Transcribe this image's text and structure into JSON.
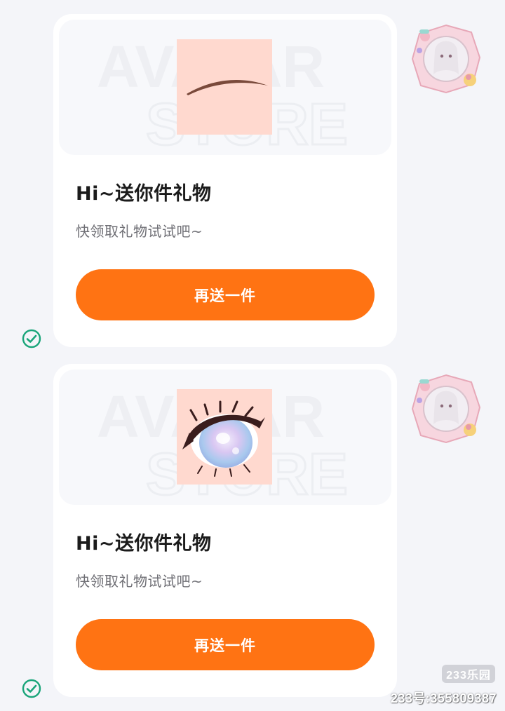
{
  "messages": [
    {
      "item": "eyebrow",
      "watermark_line1": "AVATAR",
      "watermark_line2": "STORE",
      "title": "Hi~送你件礼物",
      "subtitle": "快领取礼物试试吧~",
      "button_label": "再送一件",
      "status": "sent"
    },
    {
      "item": "eye",
      "watermark_line1": "AVATAR",
      "watermark_line2": "STORE",
      "title": "Hi~送你件礼物",
      "subtitle": "快领取礼物试试吧~",
      "button_label": "再送一件",
      "status": "sent"
    }
  ],
  "icons": {
    "status": "check-circle-icon",
    "avatar": "user-avatar"
  },
  "colors": {
    "accent": "#ff7313",
    "check": "#1aa57a",
    "card_bg": "#ffffff",
    "page_bg": "#f4f5f9"
  },
  "footer": {
    "site_badge": "233乐园",
    "site_id": "233号:355809387"
  }
}
